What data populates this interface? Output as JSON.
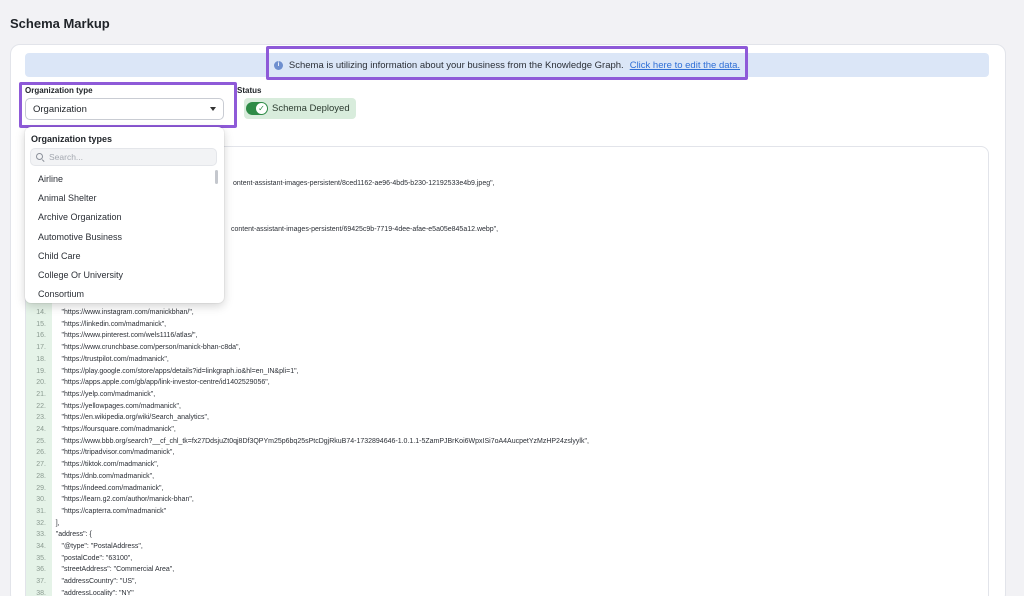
{
  "page_title": "Schema Markup",
  "banner": {
    "message": "Schema is utilizing information about your business from the Knowledge Graph.",
    "link_text": "Click here to edit the data."
  },
  "org_type": {
    "label": "Organization type",
    "selected": "Organization"
  },
  "status": {
    "label": "Status",
    "toggle_text": "Schema Deployed"
  },
  "dropdown": {
    "header": "Organization types",
    "search_placeholder": "Search...",
    "items": [
      "Airline",
      "Animal Shelter",
      "Archive Organization",
      "Automotive Business",
      "Child Care",
      "College Or University",
      "Consortium"
    ]
  },
  "code": {
    "partial_lines": [
      "ontent-assistant-images-persistent/8ced1162-ae96-4bd5-b230-12192533e4b9.jpeg\",",
      "content-assistant-images-persistent/69425c9b-7719-4dee-afae-e5a05e845a12.webp\","
    ],
    "lines": [
      {
        "n": "14.",
        "t": "        \"https://www.instagram.com/manickbhan/\","
      },
      {
        "n": "15.",
        "t": "        \"https://linkedin.com/madmanick\","
      },
      {
        "n": "16.",
        "t": "        \"https://www.pinterest.com/wels1116/atlas/\","
      },
      {
        "n": "17.",
        "t": "        \"https://www.crunchbase.com/person/manick-bhan-c8da\","
      },
      {
        "n": "18.",
        "t": "        \"https://trustpilot.com/madmanick\","
      },
      {
        "n": "19.",
        "t": "        \"https://play.google.com/store/apps/details?id=linkgraph.io&hl=en_IN&pli=1\","
      },
      {
        "n": "20.",
        "t": "        \"https://apps.apple.com/gb/app/link-investor-centre/id1402529056\","
      },
      {
        "n": "21.",
        "t": "        \"https://yelp.com/madmanick\","
      },
      {
        "n": "22.",
        "t": "        \"https://yellowpages.com/madmanick\","
      },
      {
        "n": "23.",
        "t": "        \"https://en.wikipedia.org/wiki/Search_analytics\","
      },
      {
        "n": "24.",
        "t": "        \"https://foursquare.com/madmanick\","
      },
      {
        "n": "25.",
        "t": "        \"https://www.bbb.org/search?__cf_chl_tk=fx27DdsjuZt0qj8Df3QPYm25p6bq25sPtcDgjRkuB74-1732894646-1.0.1.1-5ZamPJBrKoi6WpxISi7oA4AucpetYzMzHP24zslyylk\","
      },
      {
        "n": "26.",
        "t": "        \"https://tripadvisor.com/madmanick\","
      },
      {
        "n": "27.",
        "t": "        \"https://tiktok.com/madmanick\","
      },
      {
        "n": "28.",
        "t": "        \"https://dnb.com/madmanick\","
      },
      {
        "n": "29.",
        "t": "        \"https://indeed.com/madmanick\","
      },
      {
        "n": "30.",
        "t": "        \"https://learn.g2.com/author/manick-bhan\","
      },
      {
        "n": "31.",
        "t": "        \"https://capterra.com/madmanick\""
      },
      {
        "n": "32.",
        "t": "     ],"
      },
      {
        "n": "33.",
        "t": "     \"address\": {"
      },
      {
        "n": "34.",
        "t": "        \"@type\": \"PostalAddress\","
      },
      {
        "n": "35.",
        "t": "        \"postalCode\": \"63100\","
      },
      {
        "n": "36.",
        "t": "        \"streetAddress\": \"Commercial Area\","
      },
      {
        "n": "37.",
        "t": "        \"addressCountry\": \"US\","
      },
      {
        "n": "38.",
        "t": "        \"addressLocality\": \"NY\""
      }
    ]
  },
  "colors": {
    "highlight": "#8e5ad8",
    "banner_bg": "#dbe6f7",
    "link": "#2f6fd6",
    "toggle_on": "#2e8b47",
    "status_bg": "#d8ecdc",
    "gutter_bg": "#e5f3e8"
  }
}
